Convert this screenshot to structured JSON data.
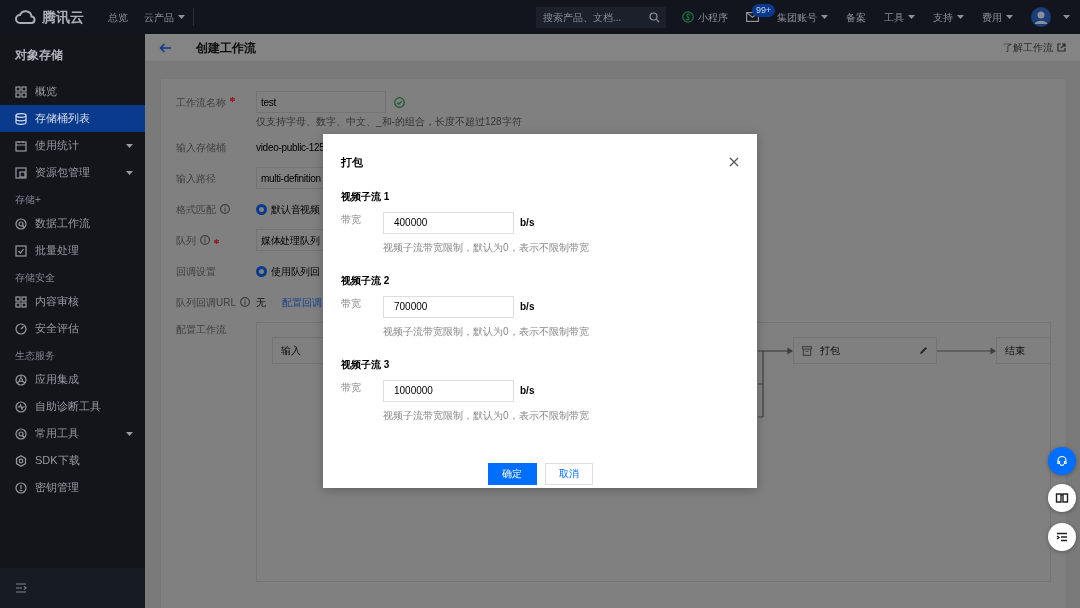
{
  "topbar": {
    "logo": "腾讯云",
    "nav": [
      {
        "label": "总览",
        "dropdown": false
      },
      {
        "label": "云产品",
        "dropdown": true
      }
    ],
    "search": {
      "placeholder": "搜索产品、文档..."
    },
    "items": [
      {
        "kind": "miniprogram",
        "label": "小程序"
      },
      {
        "kind": "mail",
        "badge": "99+"
      },
      {
        "kind": "menu",
        "label": "集团账号",
        "dropdown": true
      },
      {
        "kind": "menu",
        "label": "备案",
        "dropdown": false
      },
      {
        "kind": "menu",
        "label": "工具",
        "dropdown": true
      },
      {
        "kind": "menu",
        "label": "支持",
        "dropdown": true
      },
      {
        "kind": "menu",
        "label": "费用",
        "dropdown": true
      },
      {
        "kind": "avatar",
        "dropdown": true
      }
    ]
  },
  "sidebar": {
    "title": "对象存储",
    "sections": [
      {
        "items": [
          {
            "label": "概览",
            "selected": false,
            "expandable": false
          },
          {
            "label": "存储桶列表",
            "selected": true,
            "expandable": false
          },
          {
            "label": "使用统计",
            "selected": false,
            "expandable": true
          },
          {
            "label": "资源包管理",
            "selected": false,
            "expandable": true
          }
        ]
      },
      {
        "heading": "存储+",
        "items": [
          {
            "label": "数据工作流",
            "selected": false,
            "expandable": false
          },
          {
            "label": "批量处理",
            "selected": false,
            "expandable": false
          }
        ]
      },
      {
        "heading": "存储安全",
        "items": [
          {
            "label": "内容审核",
            "selected": false,
            "expandable": false
          },
          {
            "label": "安全评估",
            "selected": false,
            "expandable": false
          }
        ]
      },
      {
        "heading": "生态服务",
        "items": [
          {
            "label": "应用集成",
            "selected": false,
            "expandable": false
          },
          {
            "label": "自助诊断工具",
            "selected": false,
            "expandable": false
          },
          {
            "label": "常用工具",
            "selected": false,
            "expandable": true
          },
          {
            "label": "SDK下载",
            "selected": false,
            "expandable": false
          },
          {
            "label": "密钥管理",
            "selected": false,
            "expandable": false
          }
        ]
      }
    ]
  },
  "page": {
    "title": "创建工作流",
    "help_link": "了解工作流",
    "form": [
      {
        "kind": "input",
        "label": "工作流名称",
        "required": true,
        "info": false,
        "value": "test",
        "valid": true,
        "hint": "仅支持字母、数字、中文、_和-的组合，长度不超过128字符"
      },
      {
        "kind": "text",
        "label": "输入存储桶",
        "required": false,
        "info": false,
        "value": "video-public-125"
      },
      {
        "kind": "input",
        "label": "输入路径",
        "required": false,
        "info": false,
        "value": "multi-definition",
        "valid": false
      },
      {
        "kind": "radio",
        "label": "格式匹配",
        "required": false,
        "info": true,
        "value": "默认音视频",
        "selected": true
      },
      {
        "kind": "input",
        "label": "队列",
        "required": true,
        "info": true,
        "value": "媒体处理队列",
        "valid": false
      },
      {
        "kind": "radio",
        "label": "回调设置",
        "required": false,
        "info": false,
        "value": "使用队列回",
        "selected": true
      },
      {
        "kind": "url",
        "label": "队列回调URL",
        "required": false,
        "info": true,
        "value": "无",
        "link": "配置回调"
      },
      {
        "kind": "workflow",
        "label": "配置工作流",
        "required": false,
        "info": false,
        "nodes": [
          {
            "label": "输入",
            "kind": "start"
          },
          {
            "label": "打包",
            "kind": "package",
            "editable": true
          },
          {
            "label": "结束",
            "kind": "end"
          }
        ]
      }
    ]
  },
  "modal": {
    "title": "打包",
    "streams": [
      {
        "heading": "视频子流 1",
        "field_label": "带宽",
        "value": "400000",
        "unit": "b/s",
        "hint": "视频子流带宽限制，默认为0，表示不限制带宽"
      },
      {
        "heading": "视频子流 2",
        "field_label": "带宽",
        "value": "700000",
        "unit": "b/s",
        "hint": "视频子流带宽限制，默认为0，表示不限制带宽"
      },
      {
        "heading": "视频子流 3",
        "field_label": "带宽",
        "value": "1000000",
        "unit": "b/s",
        "hint": "视频子流带宽限制，默认为0，表示不限制带宽"
      }
    ],
    "buttons": [
      {
        "label": "确定",
        "primary": true
      },
      {
        "label": "取消",
        "primary": false
      }
    ]
  },
  "float_buttons": [
    {
      "kind": "support",
      "highlighted": true
    },
    {
      "kind": "docs",
      "highlighted": false
    },
    {
      "kind": "outline",
      "highlighted": false
    }
  ]
}
